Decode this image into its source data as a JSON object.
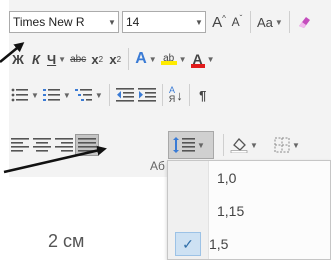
{
  "toolbar": {
    "font_name": "Times New R",
    "font_size": "14",
    "grow_font": "A",
    "shrink_font": "A",
    "change_case": "Aa",
    "bold": "Ж",
    "italic": "К",
    "underline": "Ч",
    "strikethrough": "abc",
    "subscript": "x",
    "subscript_mark": "2",
    "superscript": "x",
    "superscript_mark": "2",
    "text_effects": "A",
    "highlight": "ab",
    "font_color": "A",
    "sort": "A",
    "sort_sub": "Я",
    "pilcrow": "¶"
  },
  "group_label": "Аб",
  "line_spacing_menu": {
    "items": [
      {
        "label": "1,0",
        "checked": false
      },
      {
        "label": "1,15",
        "checked": false
      },
      {
        "label": "1,5",
        "checked": true
      }
    ]
  },
  "document": {
    "ruler_text": "2 см"
  },
  "colors": {
    "highlight": "#ffeb00",
    "font_color": "#e11b1b",
    "check_bg": "#cde1f3"
  }
}
